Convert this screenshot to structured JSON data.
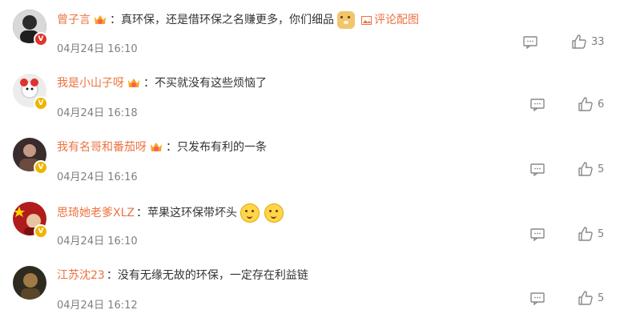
{
  "comments": [
    {
      "username": "曾子言",
      "text": "：真环保，还是借环保之名赚更多，你们细品",
      "emoji": "doge",
      "pic_link": "评论配图",
      "time": "04月24日 16:10",
      "likes": "33",
      "avatar_badge": "V"
    },
    {
      "username": "我是小山子呀",
      "text": "：不买就没有这些烦恼了",
      "time": "04月24日 16:18",
      "likes": "6",
      "avatar_badge": "V"
    },
    {
      "username": "我有名哥和番茄呀",
      "text": "：只发布有利的一条",
      "time": "04月24日 16:16",
      "likes": "5",
      "avatar_badge": "V"
    },
    {
      "username": "思琦她老爹XLZ",
      "text": "：苹果这环保带坏头",
      "emojis": [
        "thinking",
        "thinking"
      ],
      "time": "04月24日 16:10",
      "likes": "5",
      "avatar_badge": "V"
    },
    {
      "username": "江苏沈23",
      "text": "：没有无缘无故的环保，一定存在利益链",
      "time": "04月24日 16:12",
      "likes": "5"
    }
  ],
  "colors": {
    "username": "#eb7340",
    "text": "#333333",
    "meta": "#808080"
  }
}
